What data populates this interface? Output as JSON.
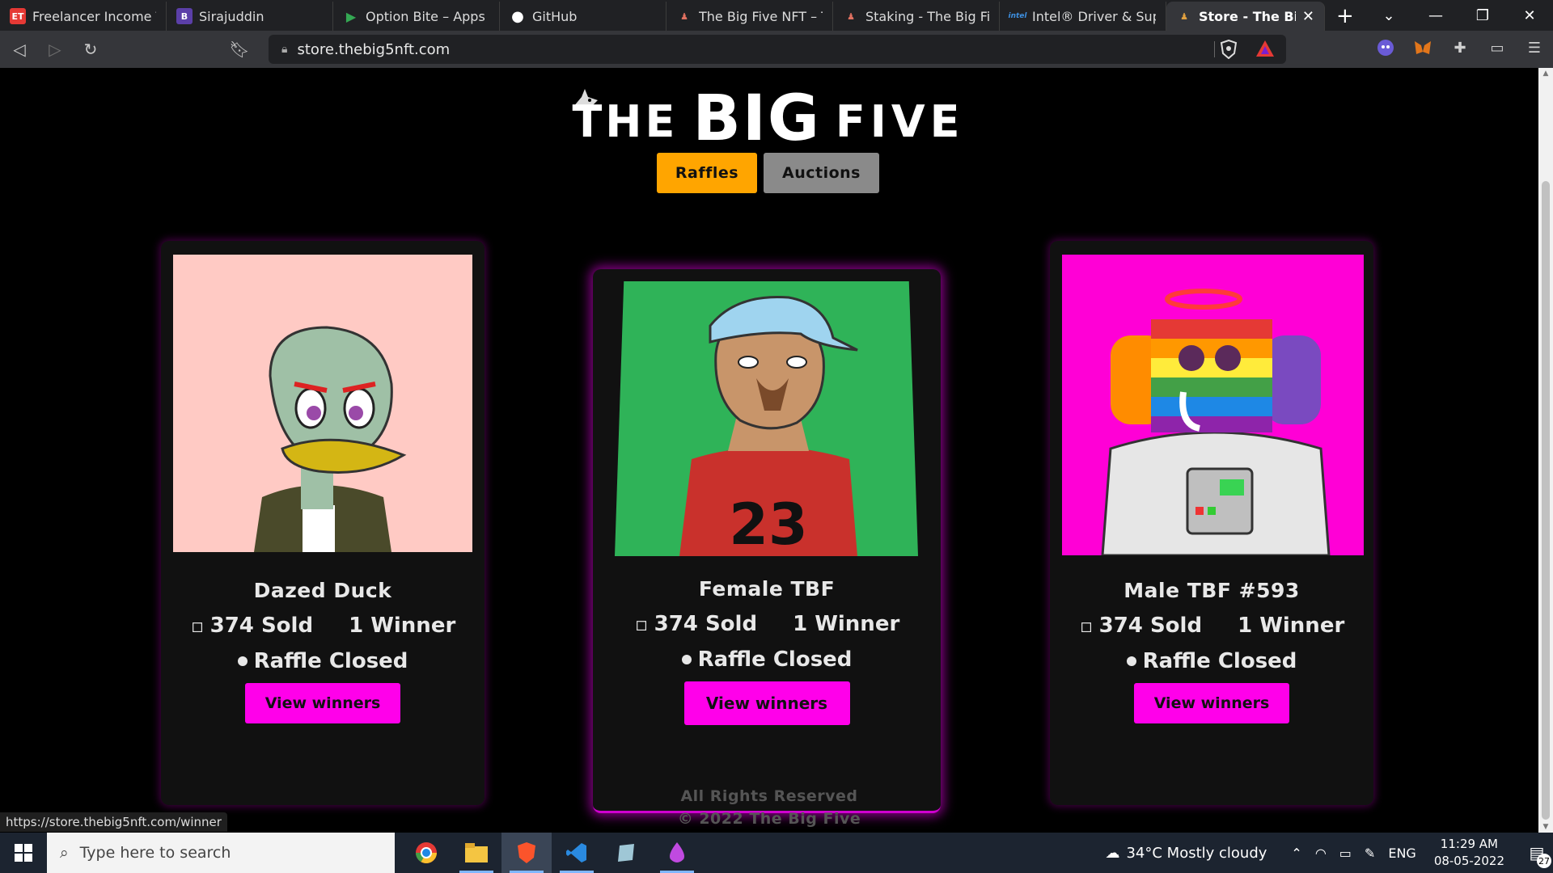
{
  "browser": {
    "tabs": [
      {
        "title": "Freelancer Income Tax:",
        "favicon_text": "ET",
        "favicon_color": "#e53935"
      },
      {
        "title": "Sirajuddin",
        "favicon_text": "B",
        "favicon_color": "#5b3fa8"
      },
      {
        "title": "Option Bite – Apps on",
        "favicon_text": "▶",
        "favicon_color": "#202124"
      },
      {
        "title": "GitHub",
        "favicon_text": "●",
        "favicon_color": "#202124"
      },
      {
        "title": "The Big Five NFT – The",
        "favicon_text": "♟",
        "favicon_color": "#202124"
      },
      {
        "title": "Staking - The Big Five N",
        "favicon_text": "♟",
        "favicon_color": "#202124"
      },
      {
        "title": "Intel® Driver & Suppo",
        "favicon_text": "intel",
        "favicon_color": "#0068b5"
      },
      {
        "title": "Store - The Big Five",
        "favicon_text": "♟",
        "favicon_color": "#202124",
        "active": true
      }
    ],
    "url": "store.thebig5nft.com",
    "status_link": "https://store.thebig5nft.com/winner"
  },
  "site": {
    "logo": {
      "word1": "THE",
      "word2": "BIG",
      "word3": "FIVE"
    },
    "tabs": {
      "raffles": "Raffles",
      "auctions": "Auctions"
    },
    "colors": {
      "raffles_tab": "#ffa500",
      "auctions_tab": "#8a8a8a",
      "button": "#ff00ea"
    },
    "cards": [
      {
        "name": "Dazed Duck",
        "sold": "374 Sold",
        "winners": "1 Winner",
        "status": "Raffle Closed",
        "button": "View winners"
      },
      {
        "name": "Female TBF",
        "sold": "374 Sold",
        "winners": "1 Winner",
        "status": "Raffle Closed",
        "button": "View winners"
      },
      {
        "name": "Male TBF #593",
        "sold": "374 Sold",
        "winners": "1 Winner",
        "status": "Raffle Closed",
        "button": "View winners"
      }
    ],
    "footer": {
      "line1": "All Rights Reserved",
      "line2": "© 2022 The Big Five"
    }
  },
  "taskbar": {
    "search_placeholder": "Type here to search",
    "weather": "34°C  Mostly cloudy",
    "lang": "ENG",
    "time": "11:29 AM",
    "date": "08-05-2022",
    "notifications": "27"
  }
}
